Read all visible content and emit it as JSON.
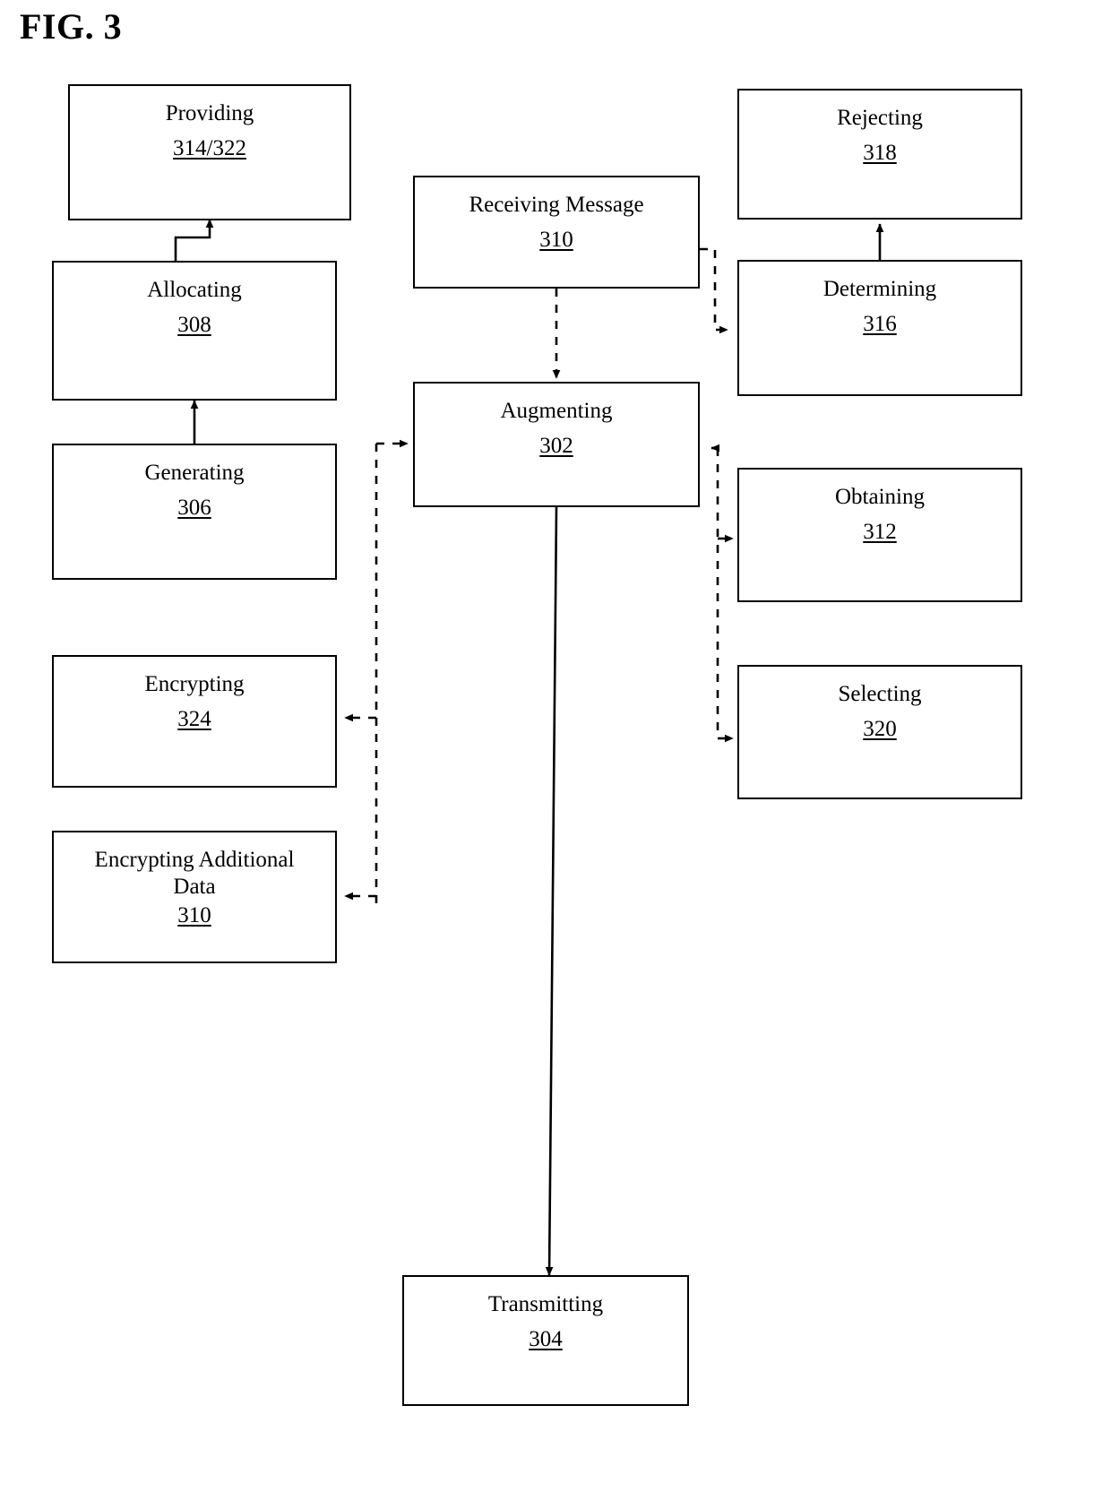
{
  "figure": {
    "title": "FIG. 3",
    "type": "patent-flow-diagram"
  },
  "nodes": {
    "providing": {
      "label": "Providing",
      "number": "314/322"
    },
    "allocating": {
      "label": "Allocating",
      "number": "308"
    },
    "generating": {
      "label": "Generating",
      "number": "306"
    },
    "encrypting": {
      "label": "Encrypting",
      "number": "324"
    },
    "encrypting_additional": {
      "label": "Encrypting Additional\nData",
      "number": "310"
    },
    "receiving": {
      "label": "Receiving Message",
      "number": "310"
    },
    "augmenting": {
      "label": "Augmenting",
      "number": "302"
    },
    "transmitting": {
      "label": "Transmitting",
      "number": "304"
    },
    "rejecting": {
      "label": "Rejecting",
      "number": "318"
    },
    "determining": {
      "label": "Determining",
      "number": "316"
    },
    "obtaining": {
      "label": "Obtaining",
      "number": "312"
    },
    "selecting": {
      "label": "Selecting",
      "number": "320"
    }
  },
  "edges": [
    {
      "name": "generating-to-allocating",
      "from": "generating",
      "to": "allocating",
      "style": "solid"
    },
    {
      "name": "allocating-to-providing",
      "from": "allocating",
      "to": "providing",
      "style": "solid"
    },
    {
      "name": "receiving-to-augmenting",
      "from": "receiving",
      "to": "augmenting",
      "style": "dashed"
    },
    {
      "name": "receiving-to-determining",
      "from": "receiving",
      "to": "determining",
      "style": "dashed"
    },
    {
      "name": "determining-to-rejecting",
      "from": "determining",
      "to": "rejecting",
      "style": "solid"
    },
    {
      "name": "augmenting-to-obtaining",
      "from": "augmenting",
      "to": "obtaining",
      "style": "dashed"
    },
    {
      "name": "augmenting-to-selecting",
      "from": "augmenting",
      "to": "selecting",
      "style": "dashed"
    },
    {
      "name": "right-bus-to-augmenting",
      "from": "right-bus",
      "to": "augmenting",
      "style": "dashed"
    },
    {
      "name": "left-bus-to-augmenting",
      "from": "left-bus",
      "to": "augmenting",
      "style": "dashed"
    },
    {
      "name": "left-bus-to-encrypting",
      "from": "left-bus",
      "to": "encrypting",
      "style": "dashed"
    },
    {
      "name": "left-bus-to-encrypting-additional",
      "from": "left-bus",
      "to": "encrypting_additional",
      "style": "dashed"
    },
    {
      "name": "augmenting-to-transmitting",
      "from": "augmenting",
      "to": "transmitting",
      "style": "solid"
    }
  ],
  "colors": {
    "stroke": "#000000",
    "background": "#ffffff"
  }
}
